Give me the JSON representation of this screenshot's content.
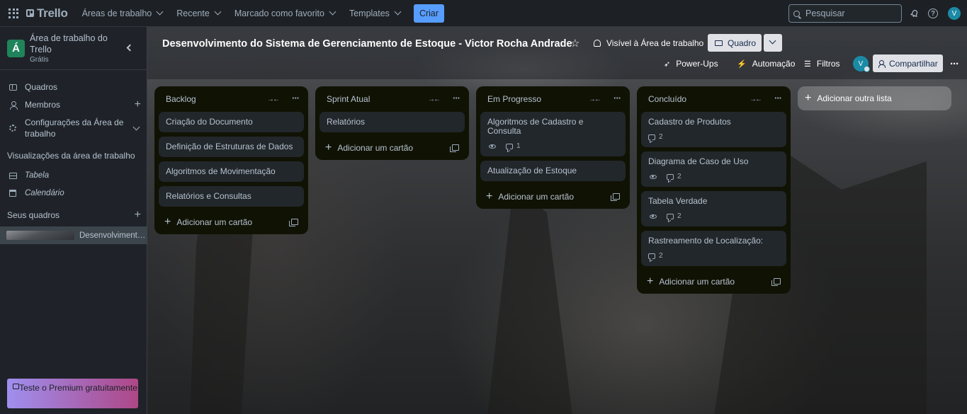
{
  "topbar": {
    "brand": "Trello",
    "nav": [
      {
        "label": "Áreas de trabalho"
      },
      {
        "label": "Recente"
      },
      {
        "label": "Marcado como favorito"
      },
      {
        "label": "Templates"
      }
    ],
    "create_label": "Criar",
    "search_placeholder": "Pesquisar",
    "avatar_initial": "V"
  },
  "sidebar": {
    "workspace_badge": "Á",
    "workspace_name": "Área de trabalho do Trello",
    "workspace_plan": "Grátis",
    "items": [
      {
        "label": "Quadros",
        "icon": "board-icon"
      },
      {
        "label": "Membros",
        "icon": "person-icon"
      },
      {
        "label": "Configurações da Área de trabalho",
        "icon": "gear-icon"
      }
    ],
    "views_title": "Visualizações da área de trabalho",
    "views": [
      {
        "label": "Tabela",
        "icon": "table-icon"
      },
      {
        "label": "Calendário",
        "icon": "calendar-icon"
      }
    ],
    "boards_title": "Seus quadros",
    "active_board": "Desenvolvimento do Sistema de Gerenciamento de Estoque - Victor Rocha Andrade",
    "premium_label": "Teste o Premium gratuitamente"
  },
  "board": {
    "title": "Desenvolvimento do Sistema de Gerenciamento de Estoque - Victor Rocha Andrade",
    "visibility": "Visível à Área de trabalho",
    "view_label": "Quadro",
    "powerups_label": "Power-Ups",
    "automation_label": "Automação",
    "filters_label": "Filtros",
    "member_initial": "V",
    "share_label": "Compartilhar",
    "add_card_label": "Adicionar um cartão",
    "add_list_label": "Adicionar outra lista",
    "lists": [
      {
        "name": "Backlog",
        "cards": [
          {
            "title": "Criação do Documento"
          },
          {
            "title": "Definição de Estruturas de Dados"
          },
          {
            "title": "Algoritmos de Movimentação"
          },
          {
            "title": "Relatórios e Consultas"
          }
        ]
      },
      {
        "name": "Sprint Atual",
        "cards": [
          {
            "title": "Relatórios"
          }
        ]
      },
      {
        "name": "Em Progresso",
        "cards": [
          {
            "title": "Algoritmos de Cadastro e Consulta",
            "watching": true,
            "comments": "1"
          },
          {
            "title": "Atualização de Estoque"
          }
        ]
      },
      {
        "name": "Concluído",
        "cards": [
          {
            "title": "Cadastro de Produtos",
            "watching": false,
            "comments": "2"
          },
          {
            "title": "Diagrama de Caso de Uso",
            "watching": true,
            "comments": "2"
          },
          {
            "title": "Tabela Verdade",
            "watching": true,
            "comments": "2"
          },
          {
            "title": "Rastreamento de Localização:",
            "watching": false,
            "comments": "2"
          }
        ]
      }
    ]
  }
}
